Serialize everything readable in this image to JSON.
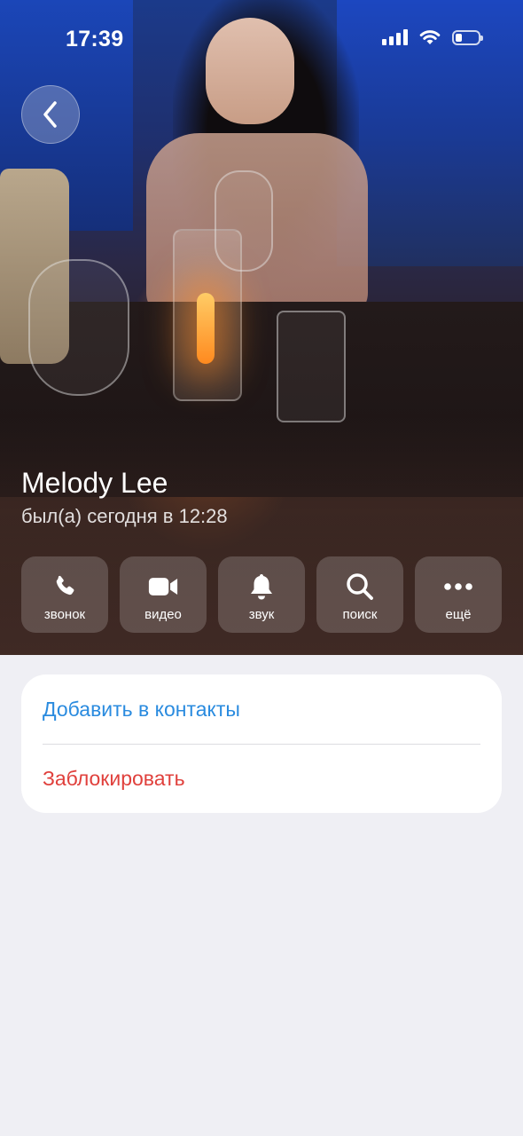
{
  "status_bar": {
    "time": "17:39",
    "icons": [
      "signal-icon",
      "wifi-icon",
      "battery-icon"
    ],
    "battery_level": 0.3
  },
  "profile": {
    "name": "Melody Lee",
    "last_seen": "был(а) сегодня в 12:28"
  },
  "actions": [
    {
      "label": "звонок",
      "icon": "phone-icon"
    },
    {
      "label": "видео",
      "icon": "video-camera-icon"
    },
    {
      "label": "звук",
      "icon": "bell-icon"
    },
    {
      "label": "поиск",
      "icon": "search-icon"
    },
    {
      "label": "ещё",
      "icon": "more-icon"
    }
  ],
  "contact_menu": {
    "add_to_contacts": "Добавить в контакты",
    "block": "Заблокировать"
  },
  "colors": {
    "link_blue": "#2a8bdf",
    "destructive_red": "#e0403c",
    "background": "#efeff4"
  }
}
